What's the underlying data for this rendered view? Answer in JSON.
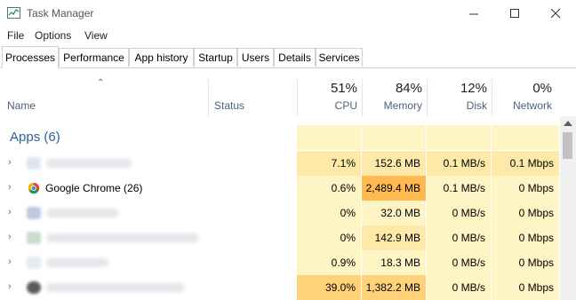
{
  "window": {
    "title": "Task Manager",
    "icon": "task-manager-icon"
  },
  "menu": [
    "File",
    "Options",
    "View"
  ],
  "tabs": [
    "Processes",
    "Performance",
    "App history",
    "Startup",
    "Users",
    "Details",
    "Services"
  ],
  "active_tab": "Processes",
  "columns": {
    "name": "Name",
    "status": "Status",
    "cpu": {
      "pct": "51%",
      "label": "CPU"
    },
    "memory": {
      "pct": "84%",
      "label": "Memory"
    },
    "disk": {
      "pct": "12%",
      "label": "Disk"
    },
    "network": {
      "pct": "0%",
      "label": "Network"
    }
  },
  "group": {
    "title": "Apps (6)"
  },
  "rows": [
    {
      "name": "",
      "cpu": "7.1%",
      "memory": "152.6 MB",
      "disk": "0.1 MB/s",
      "network": "0.1 Mbps"
    },
    {
      "name": "Google Chrome (26)",
      "cpu": "0.6%",
      "memory": "2,489.4 MB",
      "disk": "0.1 MB/s",
      "network": "0 Mbps"
    },
    {
      "name": "",
      "cpu": "0%",
      "memory": "32.0 MB",
      "disk": "0 MB/s",
      "network": "0 Mbps"
    },
    {
      "name": "",
      "cpu": "0%",
      "memory": "142.9 MB",
      "disk": "0 MB/s",
      "network": "0 Mbps"
    },
    {
      "name": "",
      "cpu": "0.9%",
      "memory": "18.3 MB",
      "disk": "0 MB/s",
      "network": "0 Mbps"
    },
    {
      "name": "",
      "cpu": "39.0%",
      "memory": "1,382.2 MB",
      "disk": "0 MB/s",
      "network": "0 Mbps"
    }
  ],
  "colors": {
    "light": "#fff4c4",
    "mid": "#ffe9a8",
    "strong": "#ffd27a",
    "heavy": "#ffb94f",
    "accent": "#2d5fa0"
  }
}
